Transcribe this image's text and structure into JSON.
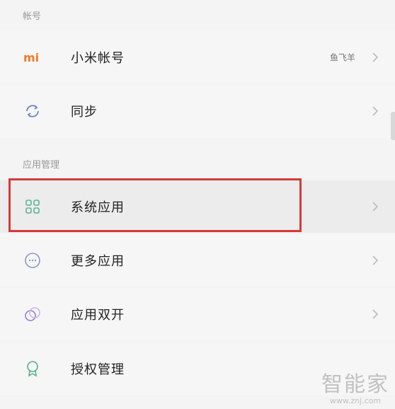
{
  "sections": {
    "account_header": "帐号",
    "apps_header": "应用管理"
  },
  "rows": {
    "mi_account": {
      "label": "小米帐号",
      "value": "鱼飞羊",
      "icon": "mi-logo-icon"
    },
    "sync": {
      "label": "同步",
      "icon": "sync-icon"
    },
    "system_apps": {
      "label": "系统应用",
      "icon": "grid-icon"
    },
    "more_apps": {
      "label": "更多应用",
      "icon": "more-icon"
    },
    "dual_apps": {
      "label": "应用双开",
      "icon": "dual-circle-icon"
    },
    "permissions": {
      "label": "授权管理",
      "icon": "badge-icon"
    }
  },
  "logo_text": "mi",
  "watermark": {
    "title": "智能家",
    "url": "www.znj.com"
  },
  "colors": {
    "mi_orange": "#f07a2a",
    "highlight_box": "#d63838",
    "grid_green": "#5ab39a",
    "dual_purple": "#9b7bd6",
    "badge_green": "#56b084"
  }
}
